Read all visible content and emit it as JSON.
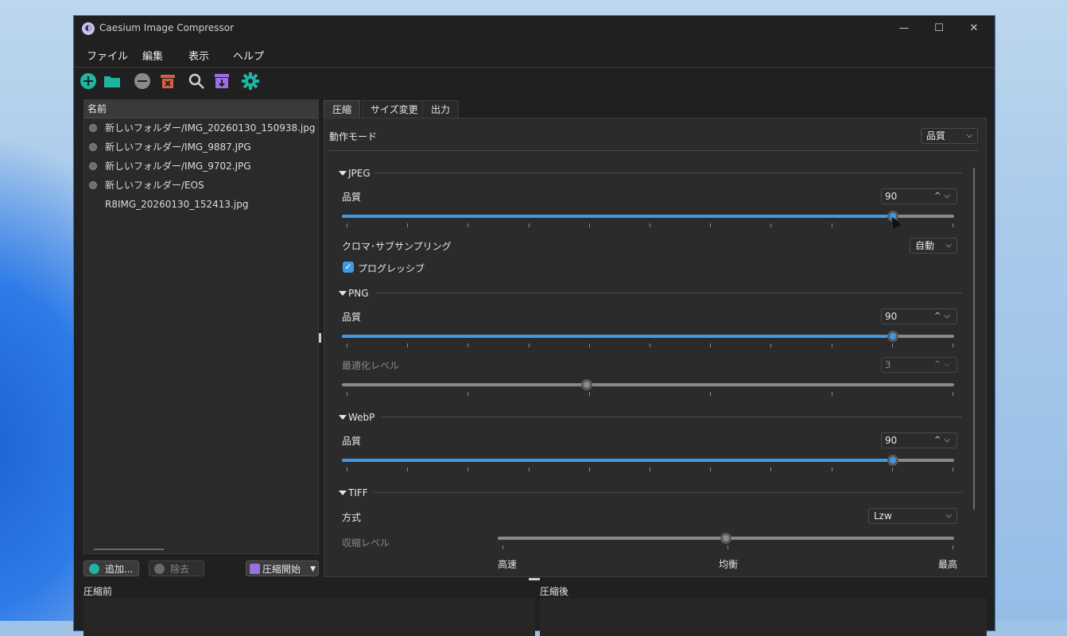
{
  "window": {
    "title": "Caesium Image Compressor"
  },
  "menu": [
    "ファイル",
    "編集",
    "表示",
    "ヘルプ"
  ],
  "toolbar_icons": [
    "add-icon",
    "open-folder-icon",
    "remove-icon",
    "clear-icon",
    "search-icon",
    "compress-icon",
    "settings-icon"
  ],
  "colors": {
    "accent": "#3f9ae6",
    "teal": "#1fb5a0",
    "red": "#d26045",
    "purple": "#9a6fe0"
  },
  "file_list": {
    "header": "名前",
    "items": [
      "新しいフォルダー/IMG_20260130_150938.jpg",
      "新しいフォルダー/IMG_9887.JPG",
      "新しいフォルダー/IMG_9702.JPG",
      "新しいフォルダー/EOS R8IMG_20260130_152413.jpg"
    ]
  },
  "buttons": {
    "add": "追加...",
    "remove": "除去",
    "start": "圧縮開始"
  },
  "tabs": [
    "圧縮",
    "サイズ変更",
    "出力"
  ],
  "settings": {
    "mode_label": "動作モード",
    "mode_value": "品質",
    "jpeg": {
      "title": "JPEG",
      "quality_label": "品質",
      "quality_value": "90",
      "quality": 90,
      "chroma_label": "クロマ･サブサンプリング",
      "chroma_value": "自動",
      "progressive_label": "プログレッシブ",
      "progressive_checked": true
    },
    "png": {
      "title": "PNG",
      "quality_label": "品質",
      "quality_value": "90",
      "quality": 90,
      "opt_label": "最適化レベル",
      "opt_value": "3",
      "opt_level": 3
    },
    "webp": {
      "title": "WebP",
      "quality_label": "品質",
      "quality_value": "90",
      "quality": 90
    },
    "tiff": {
      "title": "TIFF",
      "method_label": "方式",
      "method_value": "Lzw",
      "level_label": "収縮レベル",
      "level_labels": [
        "高速",
        "均衡",
        "最高"
      ],
      "level_selected": "均衡"
    }
  },
  "preview": {
    "before": "圧縮前",
    "after": "圧縮後"
  }
}
